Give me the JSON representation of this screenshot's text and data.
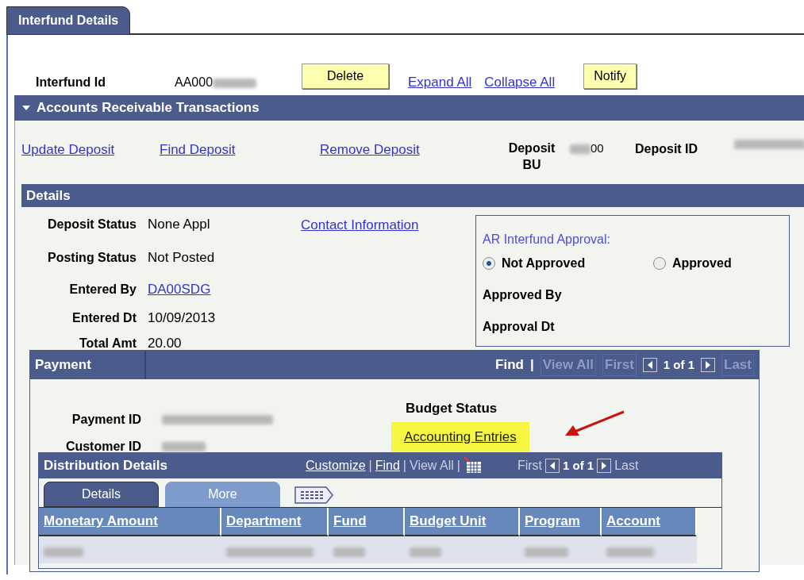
{
  "tab": {
    "label": "Interfund Details",
    "selected": true
  },
  "interfund": {
    "label": "Interfund Id",
    "value": "AA000"
  },
  "toolbar": [
    {
      "kind": "button",
      "label": "Delete"
    },
    {
      "kind": "link",
      "label": "Expand All"
    },
    {
      "kind": "link",
      "label": "Collapse All"
    },
    {
      "kind": "button",
      "label": "Notify"
    }
  ],
  "ar_section": {
    "title": "Accounts Receivable Transactions",
    "expanded": true,
    "links": [
      "Update Deposit",
      "Find Deposit",
      "Remove Deposit"
    ],
    "deposit_bu": {
      "label": "Deposit BU",
      "value": "00"
    },
    "deposit_id": {
      "label": "Deposit ID"
    }
  },
  "details": {
    "title": "Details",
    "fields": [
      {
        "label": "Deposit Status",
        "value": "None Appl",
        "kind": "text"
      },
      {
        "label": "Posting Status",
        "value": "Not Posted",
        "kind": "text"
      },
      {
        "label": "Entered By",
        "value": "DA00SDG",
        "kind": "link"
      },
      {
        "label": "Entered Dt",
        "value": "10/09/2013",
        "kind": "text"
      },
      {
        "label": "Total Amt",
        "value": "20.00",
        "kind": "text"
      }
    ],
    "contact_link": "Contact Information",
    "approval": {
      "title": "AR Interfund Approval:",
      "options": [
        {
          "label": "Not Approved",
          "selected": true
        },
        {
          "label": "Approved",
          "selected": false
        }
      ],
      "fields": [
        "Approved By",
        "Approval Dt"
      ]
    }
  },
  "payment": {
    "title": "Payment",
    "nav": [
      {
        "kind": "link",
        "label": "Find",
        "disabled": false
      },
      {
        "kind": "separator",
        "label": "|"
      },
      {
        "kind": "link",
        "label": "View All",
        "disabled": true
      },
      {
        "kind": "link",
        "label": "First",
        "disabled": true
      },
      {
        "kind": "prev"
      },
      {
        "kind": "count",
        "label": "1 of 1"
      },
      {
        "kind": "next"
      },
      {
        "kind": "link",
        "label": "Last",
        "disabled": true
      }
    ],
    "fields": [
      "Payment ID",
      "Customer ID"
    ],
    "budget_status": "Budget Status",
    "accounting_link": "Accounting Entries"
  },
  "distribution": {
    "title": "Distribution Details",
    "nav": [
      {
        "kind": "link",
        "label": "Customize",
        "disabled": false
      },
      {
        "kind": "separator",
        "label": "|"
      },
      {
        "kind": "link",
        "label": "Find",
        "disabled": false
      },
      {
        "kind": "separator",
        "label": "|"
      },
      {
        "kind": "link",
        "label": "View All",
        "disabled": true
      },
      {
        "kind": "separator",
        "label": "|"
      },
      {
        "kind": "grid"
      },
      {
        "kind": "link",
        "label": "First",
        "disabled": true
      },
      {
        "kind": "prev"
      },
      {
        "kind": "count",
        "label": "1 of 1"
      },
      {
        "kind": "next"
      },
      {
        "kind": "link",
        "label": "Last",
        "disabled": true
      }
    ],
    "tabs": [
      {
        "label": "Details",
        "selected": true
      },
      {
        "label": "More",
        "selected": false
      }
    ],
    "columns": [
      "Monetary Amount",
      "Department",
      "Fund",
      "Budget Unit",
      "Program",
      "Account"
    ]
  }
}
